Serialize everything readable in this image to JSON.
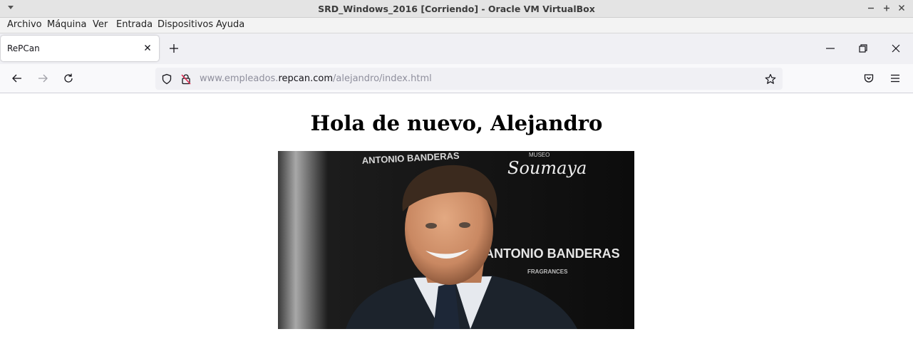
{
  "window": {
    "title": "SRD_Windows_2016 [Corriendo] - Oracle VM VirtualBox",
    "controls": [
      "minimize-icon",
      "maximize-icon",
      "close-icon"
    ]
  },
  "vbox_menu": {
    "items": [
      "Archivo",
      "Máquina",
      "Ver",
      "Entrada",
      "Dispositivos",
      "Ayuda"
    ]
  },
  "browser": {
    "tab": {
      "label": "RePCan"
    },
    "url": {
      "prefix": "www.empleados.",
      "host": "repcan.com",
      "path": "/alejandro/index.html"
    }
  },
  "page": {
    "heading": "Hola de nuevo, Alejandro",
    "photo": {
      "signs": [
        "ANTONIO BANDERAS",
        "MUSEO",
        "Soumaya",
        "ANTONIO BANDERAS",
        "FRAGRANCES"
      ]
    }
  },
  "colors": {
    "vbox_title_bg": "#e4e4e4",
    "menu_bg": "#f3f3f3",
    "tabbar_bg": "#f0f0f4",
    "navbar_bg": "#f9f9fb",
    "urlbar_bg": "#f0f0f4"
  }
}
